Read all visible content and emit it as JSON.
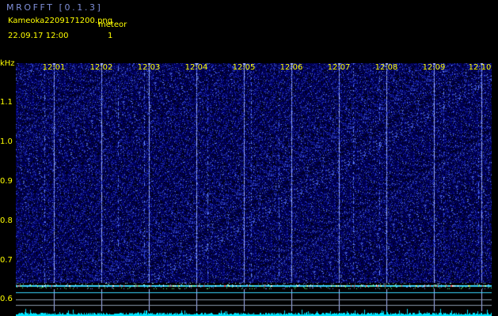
{
  "header": {
    "app_title": "MROFFT [0.1.3]",
    "file_name": "Kameoka2209171200.png",
    "meteor_label": "meteor",
    "date_time": "22.09.17 12:00",
    "meteor_count": "1"
  },
  "plot": {
    "y_unit": "kHz",
    "y_ticks": [
      "1.1",
      "1.0",
      "0.9",
      "0.8",
      "0.7",
      "0.6"
    ],
    "x_ticks": [
      "12:01",
      "12:02",
      "12:03",
      "12:04",
      "12:05",
      "12:06",
      "12:07",
      "12:08",
      "12:09",
      "12:10"
    ],
    "colors": {
      "background": "#000000",
      "noise_dark": "#00006a",
      "noise_mid": "#2b3fd0",
      "noise_bright": "#6a8cff",
      "marker_line": "#a8b8ff",
      "carrier_band": "#39d7ff",
      "signal_trace": "#00e5ff",
      "text": "#ffff00"
    }
  }
}
